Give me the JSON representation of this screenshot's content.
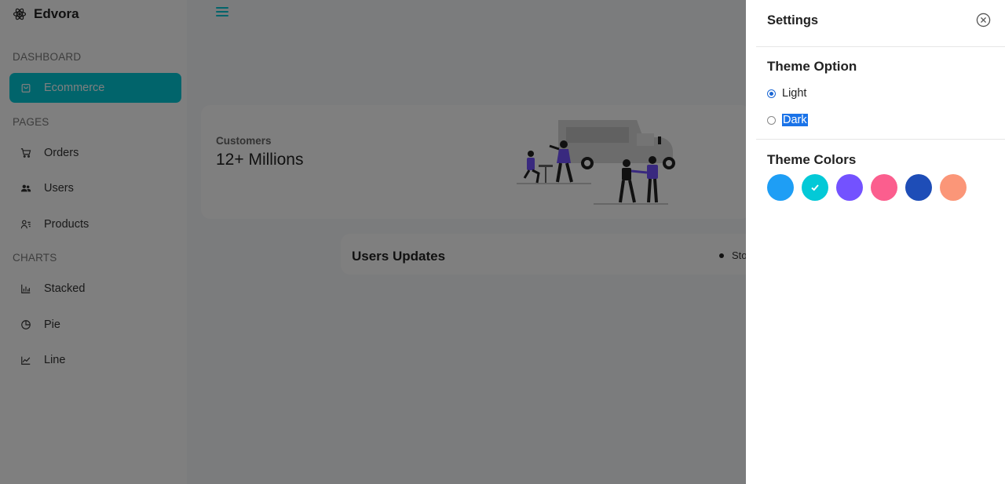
{
  "brand": {
    "name": "Edvora"
  },
  "sidebar": {
    "sections": [
      {
        "title": "DASHBOARD",
        "items": [
          {
            "label": "Ecommerce",
            "icon": "shopping-bag-icon",
            "active": true
          }
        ]
      },
      {
        "title": "PAGES",
        "items": [
          {
            "label": "Orders",
            "icon": "cart-icon"
          },
          {
            "label": "Users",
            "icon": "users-icon"
          },
          {
            "label": "Products",
            "icon": "person-lines-icon"
          }
        ]
      },
      {
        "title": "CHARTS",
        "items": [
          {
            "label": "Stacked",
            "icon": "bar-chart-icon"
          },
          {
            "label": "Pie",
            "icon": "pie-chart-icon"
          },
          {
            "label": "Line",
            "icon": "line-chart-icon"
          }
        ]
      }
    ]
  },
  "main": {
    "stat": {
      "label": "Customers",
      "value": "12+ Millions"
    },
    "updates": {
      "title": "Users Updates",
      "legend_partial": "Sto"
    }
  },
  "settings": {
    "title": "Settings",
    "theme_option": {
      "heading": "Theme Option",
      "options": [
        "Light",
        "Dark"
      ],
      "selected": "Light"
    },
    "theme_colors": {
      "heading": "Theme Colors",
      "colors": [
        "#1e9ef5",
        "#03c9d7",
        "#7352ff",
        "#fb5e8e",
        "#1e4db7",
        "#fb9678"
      ],
      "selected_index": 1
    }
  },
  "colors": {
    "accent": "#03c9d7",
    "overlay": "rgba(0,0,0,0.5)"
  }
}
